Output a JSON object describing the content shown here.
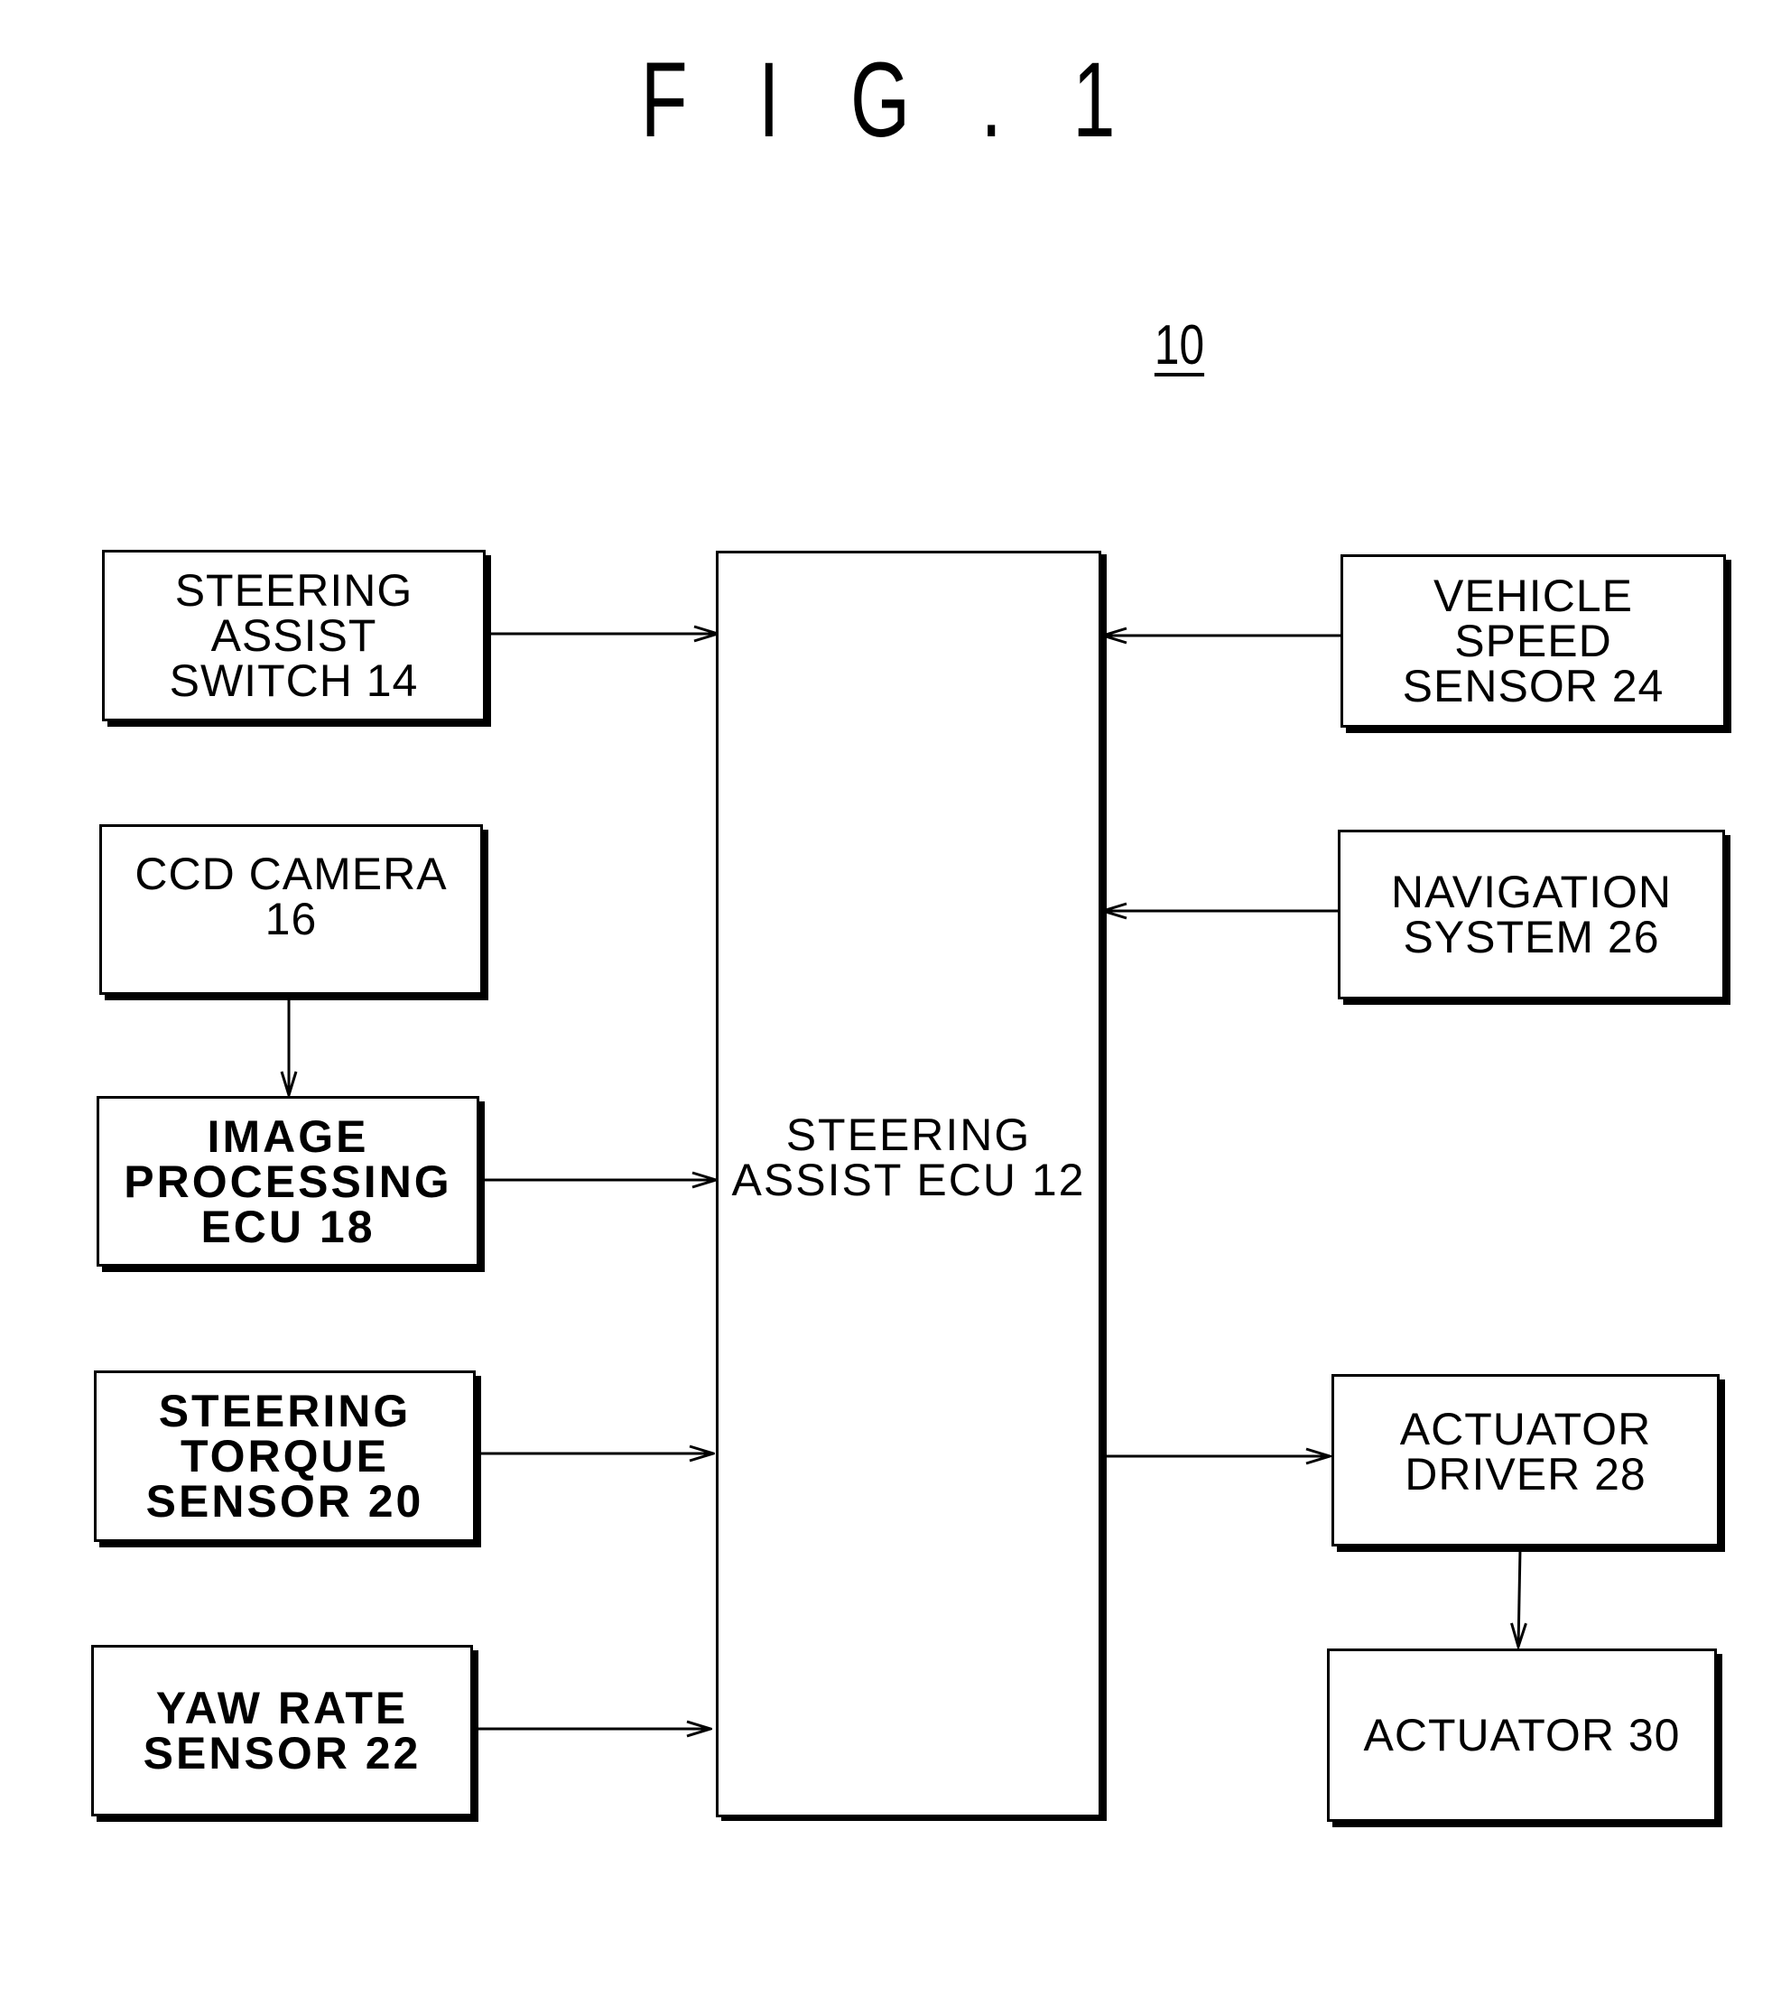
{
  "figure": {
    "title": "F I G . 1",
    "reference_numeral": "10"
  },
  "blocks": {
    "steering_assist_switch": "STEERING\nASSIST\nSWITCH 14",
    "ccd_camera": "CCD CAMERA\n16",
    "image_processing_ecu": "IMAGE\nPROCESSING\nECU 18",
    "steering_torque_sensor": "STEERING\nTORQUE\nSENSOR 20",
    "yaw_rate_sensor": "YAW RATE\nSENSOR 22",
    "steering_assist_ecu": "STEERING\nASSIST ECU 12",
    "vehicle_speed_sensor": "VEHICLE\nSPEED\nSENSOR 24",
    "navigation_system": "NAVIGATION\nSYSTEM 26",
    "actuator_driver": "ACTUATOR\nDRIVER 28",
    "actuator": "ACTUATOR 30"
  },
  "connections": [
    {
      "from": "steering_assist_switch",
      "to": "steering_assist_ecu"
    },
    {
      "from": "ccd_camera",
      "to": "image_processing_ecu"
    },
    {
      "from": "image_processing_ecu",
      "to": "steering_assist_ecu"
    },
    {
      "from": "steering_torque_sensor",
      "to": "steering_assist_ecu"
    },
    {
      "from": "yaw_rate_sensor",
      "to": "steering_assist_ecu"
    },
    {
      "from": "vehicle_speed_sensor",
      "to": "steering_assist_ecu"
    },
    {
      "from": "navigation_system",
      "to": "steering_assist_ecu"
    },
    {
      "from": "steering_assist_ecu",
      "to": "actuator_driver"
    },
    {
      "from": "actuator_driver",
      "to": "actuator"
    }
  ]
}
